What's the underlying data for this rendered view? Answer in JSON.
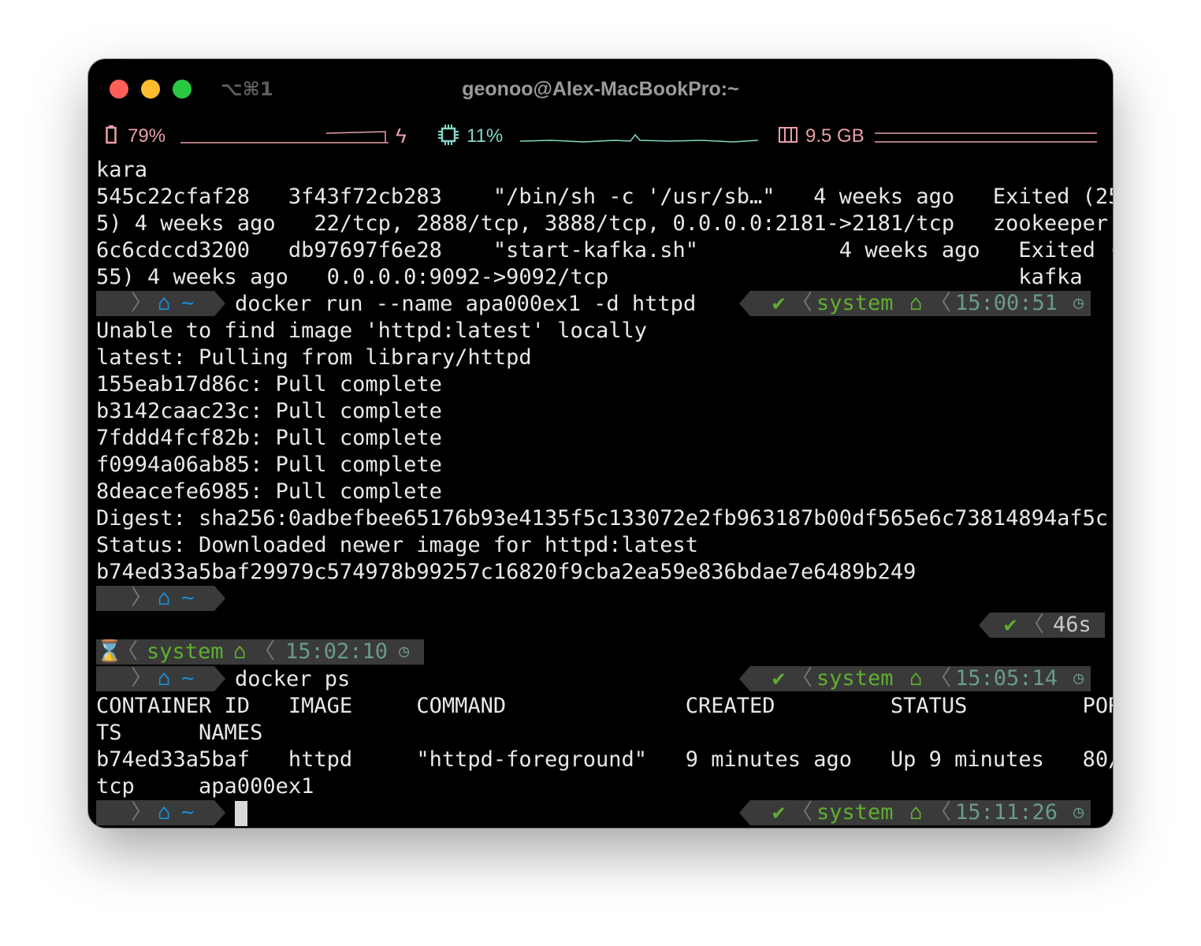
{
  "window": {
    "title": "geonoo@Alex-MacBookPro:~",
    "shortcut": "⌥⌘1"
  },
  "status_bar": {
    "battery": "79%",
    "cpu": "11%",
    "memory": "9.5 GB",
    "colors": {
      "battery": "#e8a0a8",
      "cpu": "#7fd8c8",
      "memory": "#e8a0a8"
    }
  },
  "prompt": {
    "apple_icon": "apple-icon",
    "home_icon": "home-icon",
    "home_dir": "~",
    "check": "✔",
    "env": "system",
    "duration": "46s"
  },
  "lines": {
    "l0": "kara",
    "l1": "545c22cfaf28   3f43f72cb283    \"/bin/sh -c '/usr/sb…\"   4 weeks ago   Exited (25",
    "l2": "5) 4 weeks ago   22/tcp, 2888/tcp, 3888/tcp, 0.0.0.0:2181->2181/tcp   zookeeper",
    "l3": "6c6cdccd3200   db97697f6e28    \"start-kafka.sh\"           4 weeks ago   Exited (2",
    "l4": "55) 4 weeks ago   0.0.0.0:9092->9092/tcp                                kafka",
    "cmd1": "docker run --name apa000ex1 -d httpd",
    "time1": "15:00:51",
    "l6": "Unable to find image 'httpd:latest' locally",
    "l7": "latest: Pulling from library/httpd",
    "l8": "155eab17d86c: Pull complete",
    "l9": "b3142caac23c: Pull complete",
    "l10": "7fddd4fcf82b: Pull complete",
    "l11": "f0994a06ab85: Pull complete",
    "l12": "8deacefe6985: Pull complete",
    "l13": "Digest: sha256:0adbefbee65176b93e4135f5c133072e2fb963187b00df565e6c73814894af5c",
    "l14": "Status: Downloaded newer image for httpd:latest",
    "l15": "b74ed33a5baf29979c574978b99257c16820f9cba2ea59e836bdae7e6489b249",
    "time2": "15:02:10",
    "cmd2": "docker ps",
    "time3": "15:05:14",
    "l20": "CONTAINER ID   IMAGE     COMMAND              CREATED         STATUS         POR",
    "l21": "TS      NAMES",
    "l22": "b74ed33a5baf   httpd     \"httpd-foreground\"   9 minutes ago   Up 9 minutes   80/",
    "l23": "tcp     apa000ex1",
    "time4": "15:11:26"
  }
}
